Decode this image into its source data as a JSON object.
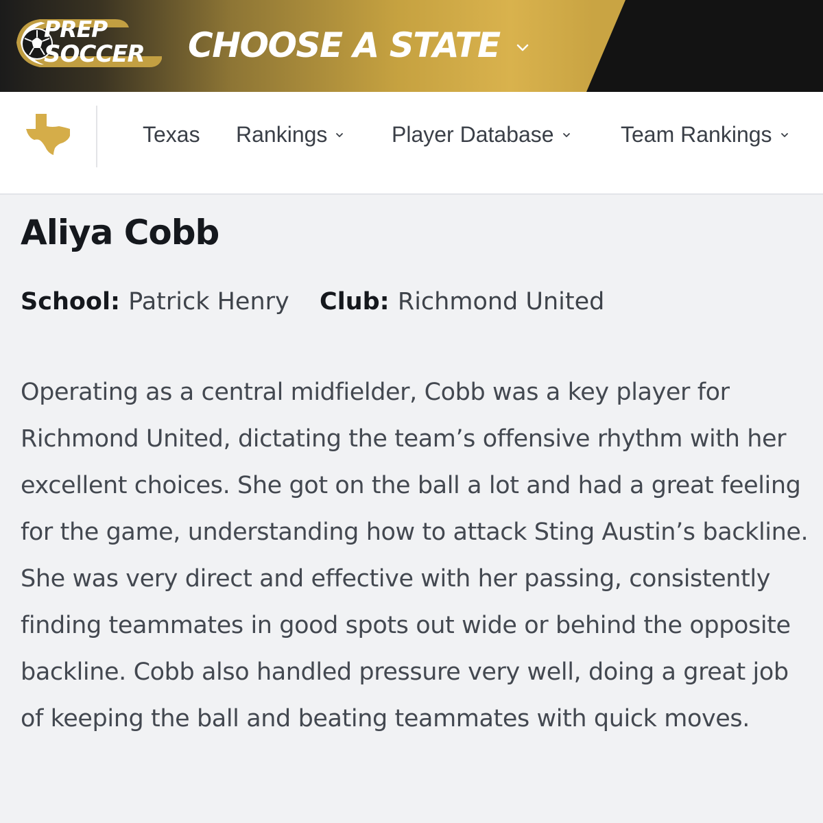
{
  "banner": {
    "logo_line1": "PREP",
    "logo_line2": "SOCCER",
    "choose_state_label": "CHOOSE A STATE",
    "colors": {
      "gold": "#d4ad48",
      "dark": "#131313"
    }
  },
  "nav": {
    "state_icon": "texas-state-icon",
    "items": [
      {
        "label": "Texas",
        "dropdown": false
      },
      {
        "label": "Rankings",
        "dropdown": true
      },
      {
        "label": "Player Database",
        "dropdown": true
      },
      {
        "label": "Team Rankings",
        "dropdown": true
      }
    ]
  },
  "player": {
    "name": "Aliya Cobb",
    "school_label": "School:",
    "school": "Patrick Henry",
    "club_label": "Club:",
    "club": "Richmond United",
    "bio": "Operating as a central midfielder, Cobb was a key player for Richmond United, dictating the team’s offensive rhythm with her excellent choices. She got on the ball a lot and had a great feeling for the game, understanding how to attack Sting Austin’s backline. She was very direct and effective with her passing, consistently finding teammates in good spots out wide or behind the opposite backline. Cobb also handled pressure very well, doing a great job of keeping the ball and beating teammates with quick moves."
  }
}
